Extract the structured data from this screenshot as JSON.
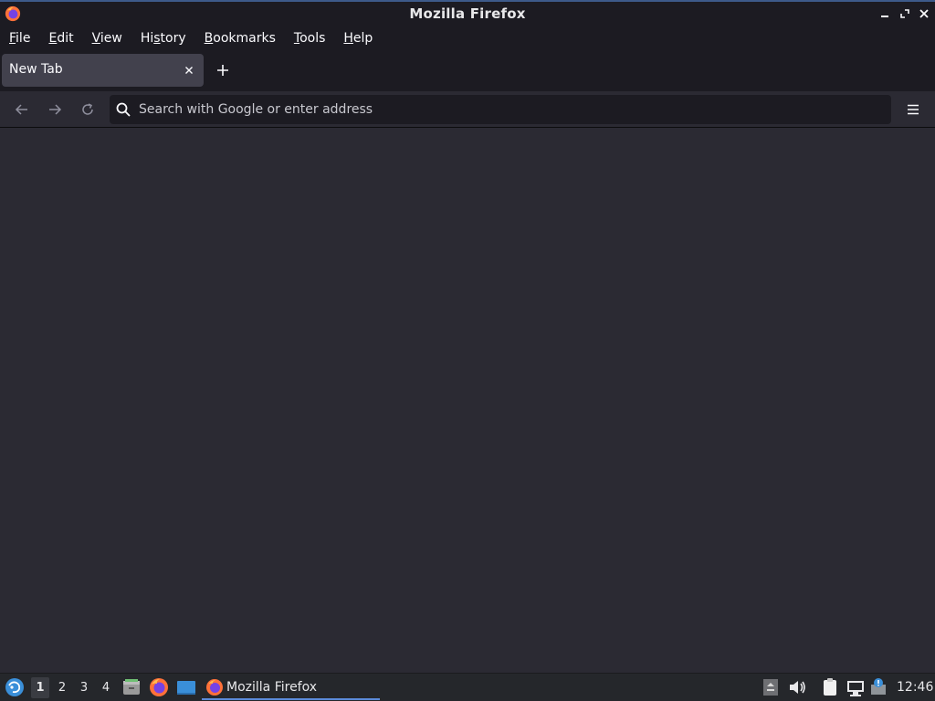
{
  "window": {
    "title": "Mozilla Firefox"
  },
  "menubar": {
    "items": [
      {
        "label": "File",
        "mnemonic": "F",
        "rest": "ile"
      },
      {
        "label": "Edit",
        "mnemonic": "E",
        "rest": "dit"
      },
      {
        "label": "View",
        "mnemonic": "V",
        "rest": "iew"
      },
      {
        "label": "History",
        "pre": "Hi",
        "mnemonic": "s",
        "rest": "tory"
      },
      {
        "label": "Bookmarks",
        "mnemonic": "B",
        "rest": "ookmarks"
      },
      {
        "label": "Tools",
        "mnemonic": "T",
        "rest": "ools"
      },
      {
        "label": "Help",
        "mnemonic": "H",
        "rest": "elp"
      }
    ]
  },
  "tabs": [
    {
      "label": "New Tab",
      "active": true
    }
  ],
  "urlbar": {
    "placeholder": "Search with Google or enter address",
    "value": ""
  },
  "taskbar": {
    "workspaces": [
      "1",
      "2",
      "3",
      "4"
    ],
    "active_workspace": "1",
    "task_label": "Mozilla Firefox",
    "clock": "12:46"
  },
  "colors": {
    "chrome": "#1c1b22",
    "toolbar": "#2b2a33",
    "tab_active": "#42414d",
    "accent": "#5b8ad8"
  },
  "icons": {
    "app": "firefox-icon",
    "tab_close": "close-icon",
    "new_tab": "plus-icon",
    "back": "arrow-left-icon",
    "forward": "arrow-right-icon",
    "reload": "reload-icon",
    "search": "search-icon",
    "menu": "hamburger-menu-icon"
  }
}
